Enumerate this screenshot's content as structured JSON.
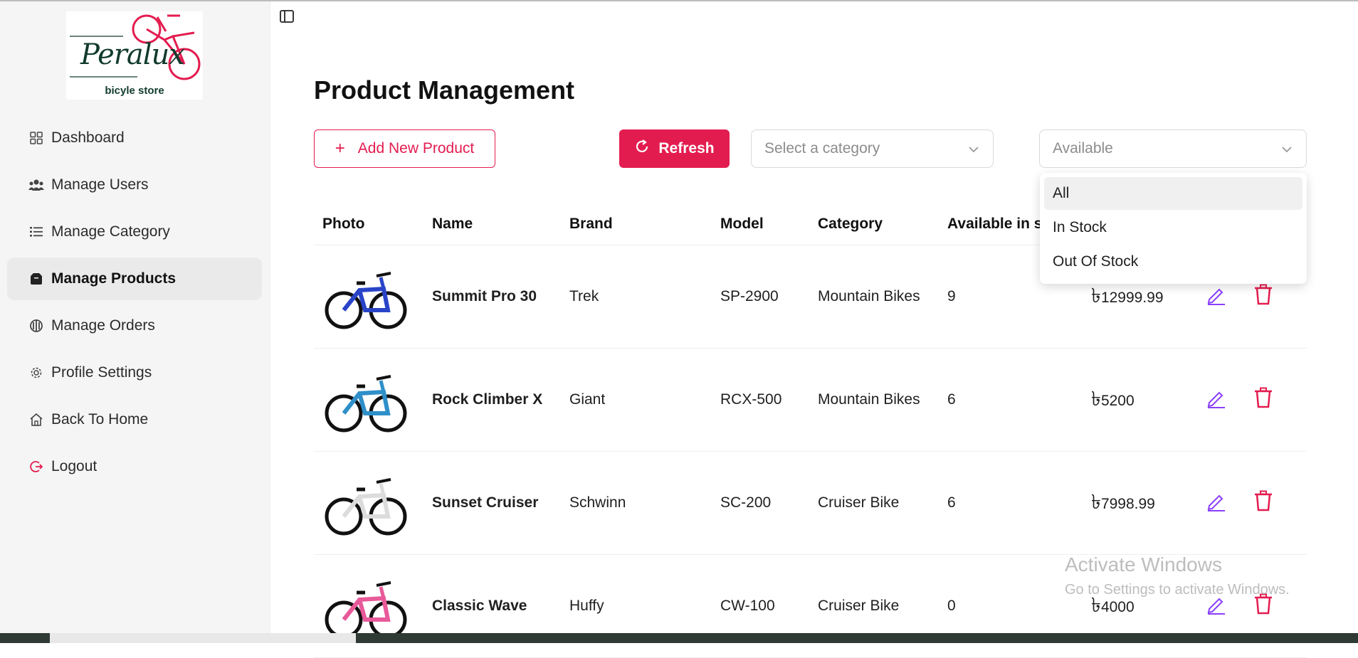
{
  "sidebar": {
    "logo": {
      "title": "Peralux",
      "subtitle": "bicyle store",
      "accent": "#e31c4f",
      "text_color": "#113b2c"
    },
    "items": [
      {
        "label": "Dashboard",
        "icon": "dashboard-icon"
      },
      {
        "label": "Manage Users",
        "icon": "users-icon"
      },
      {
        "label": "Manage Category",
        "icon": "list-icon"
      },
      {
        "label": "Manage Products",
        "icon": "product-box-icon",
        "active": true
      },
      {
        "label": "Manage Orders",
        "icon": "orders-icon"
      },
      {
        "label": "Profile Settings",
        "icon": "gear-icon"
      },
      {
        "label": "Back To Home",
        "icon": "home-icon"
      },
      {
        "label": "Logout",
        "icon": "logout-icon"
      }
    ]
  },
  "main": {
    "title": "Product Management",
    "add_button": "Add New Product",
    "refresh_button": "Refresh",
    "category_select": {
      "placeholder": "Select a category"
    },
    "availability_select": {
      "value": "Available"
    },
    "availability_options": [
      "All",
      "In Stock",
      "Out Of Stock"
    ],
    "table": {
      "headers": [
        "Photo",
        "Name",
        "Brand",
        "Model",
        "Category",
        "Available in s"
      ],
      "currency_symbol": "৳",
      "rows": [
        {
          "name": "Summit Pro 30",
          "brand": "Trek",
          "model": "SP-2900",
          "category": "Mountain Bikes",
          "stock": "9",
          "price": "12999.99",
          "frame_color": "#2a44c8"
        },
        {
          "name": "Rock Climber X",
          "brand": "Giant",
          "model": "RCX-500",
          "category": "Mountain Bikes",
          "stock": "6",
          "price": "5200",
          "frame_color": "#2f8fc9"
        },
        {
          "name": "Sunset Cruiser",
          "brand": "Schwinn",
          "model": "SC-200",
          "category": "Cruiser Bike",
          "stock": "6",
          "price": "7998.99",
          "frame_color": "#dcdcdc"
        },
        {
          "name": "Classic Wave",
          "brand": "Huffy",
          "model": "CW-100",
          "category": "Cruiser Bike",
          "stock": "0",
          "price": "4000",
          "frame_color": "#e85a9a"
        }
      ]
    }
  },
  "colors": {
    "accent": "#e31c4f",
    "edit_icon": "#8a3ffc",
    "delete_icon": "#e31c4f"
  },
  "watermark": {
    "line1": "Activate Windows",
    "line2": "Go to Settings to activate Windows."
  }
}
